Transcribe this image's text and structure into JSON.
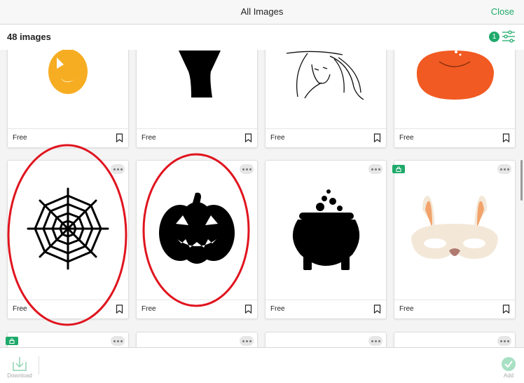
{
  "header": {
    "title": "All Images",
    "close_label": "Close"
  },
  "toolbar": {
    "count_label": "48 images",
    "filter_count": "1"
  },
  "cards": [
    {
      "label": "Free",
      "art": "pumpkin-face-icon"
    },
    {
      "label": "Free",
      "art": "tree-trunk-icon"
    },
    {
      "label": "Free",
      "art": "witch-icon"
    },
    {
      "label": "Free",
      "art": "orange-pumpkin-icon"
    },
    {
      "label": "Free",
      "art": "spider-web-icon"
    },
    {
      "label": "Free",
      "art": "jack-o-lantern-icon"
    },
    {
      "label": "Free",
      "art": "cauldron-icon"
    },
    {
      "label": "Free",
      "art": "bunny-mask-icon"
    }
  ],
  "bottom": {
    "download_label": "Download",
    "add_label": "Add"
  },
  "colors": {
    "accent": "#1faa6b",
    "highlight": "#e0141e"
  }
}
